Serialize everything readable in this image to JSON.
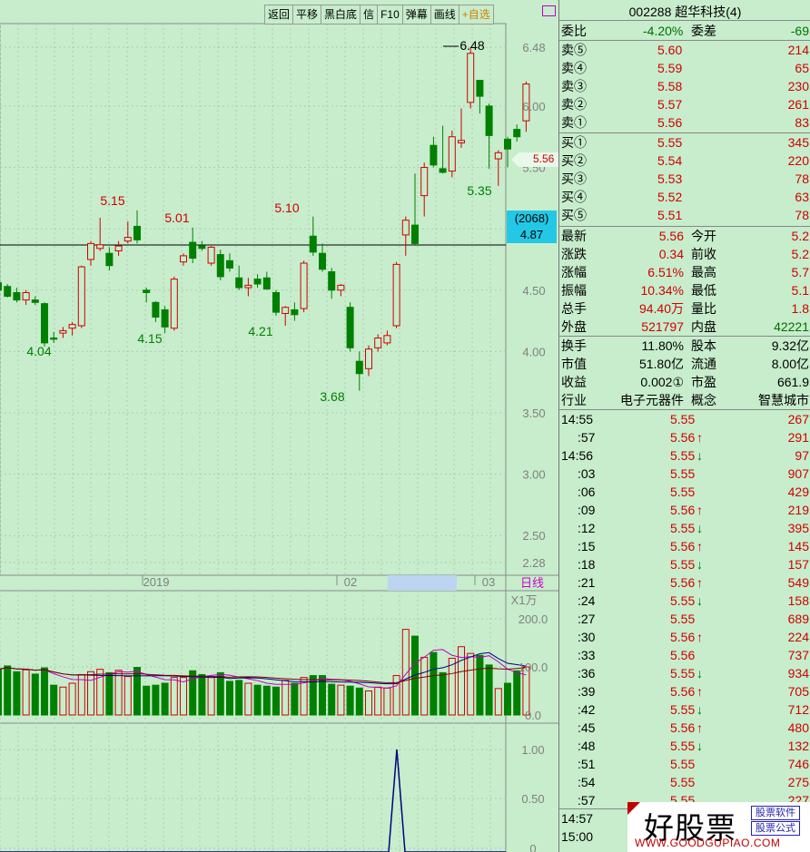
{
  "toolbar": {
    "items": [
      "返回",
      "平移",
      "黑白底",
      "信",
      "F10",
      "弹幕",
      "画线",
      "+自选"
    ]
  },
  "chart": {
    "price_axis": [
      "6.48",
      "6.00",
      "5.50",
      "5.00",
      "4.50",
      "4.00",
      "3.50",
      "3.00",
      "2.50",
      "2.28"
    ],
    "volume_axis": [
      "200.0",
      "100.0",
      "0.0"
    ],
    "volume_unit": "X1万",
    "indicator_axis": [
      "1.00",
      "0.50",
      "0"
    ],
    "date_labels": [
      "2019",
      "02",
      "03"
    ],
    "period_label": "日线",
    "annotations": [
      "6.48",
      "5.15",
      "5.01",
      "5.10",
      "5.35",
      "4.04",
      "4.15",
      "4.21",
      "3.68"
    ],
    "last_price_flag": "5.56",
    "crosshair_box": {
      "line1": "(2068)",
      "line2": "4.87"
    },
    "colors": {
      "up": "#d00000",
      "down": "#008000",
      "background": "#c7edcc",
      "ma1": "#000080",
      "ma2": "#c000c0",
      "ma3": "#800000"
    }
  },
  "chart_data": {
    "type": "candlestick",
    "candles": [
      [
        4.56,
        4.56,
        4.5,
        4.5
      ],
      [
        4.53,
        4.55,
        4.44,
        4.45
      ],
      [
        4.48,
        4.52,
        4.4,
        4.42
      ],
      [
        4.42,
        4.5,
        4.38,
        4.48
      ],
      [
        4.42,
        4.45,
        4.38,
        4.4
      ],
      [
        4.39,
        4.4,
        4.04,
        4.07
      ],
      [
        4.11,
        4.16,
        4.07,
        4.1
      ],
      [
        4.15,
        4.2,
        4.11,
        4.17
      ],
      [
        4.19,
        4.24,
        4.13,
        4.22
      ],
      [
        4.21,
        4.7,
        4.19,
        4.69
      ],
      [
        4.75,
        4.9,
        4.7,
        4.88
      ],
      [
        4.84,
        5.09,
        4.82,
        4.87
      ],
      [
        4.8,
        4.85,
        4.66,
        4.7
      ],
      [
        4.82,
        4.9,
        4.78,
        4.86
      ],
      [
        4.9,
        5.06,
        4.88,
        4.93
      ],
      [
        5.02,
        5.15,
        4.88,
        4.91
      ],
      [
        4.5,
        4.52,
        4.4,
        4.48
      ],
      [
        4.4,
        4.41,
        4.24,
        4.28
      ],
      [
        4.34,
        4.37,
        4.15,
        4.2
      ],
      [
        4.19,
        4.61,
        4.17,
        4.59
      ],
      [
        4.73,
        4.8,
        4.7,
        4.78
      ],
      [
        4.89,
        5.01,
        4.72,
        4.76
      ],
      [
        4.86,
        4.9,
        4.82,
        4.84
      ],
      [
        4.72,
        4.86,
        4.7,
        4.85
      ],
      [
        4.79,
        4.83,
        4.58,
        4.61
      ],
      [
        4.74,
        4.8,
        4.65,
        4.68
      ],
      [
        4.6,
        4.7,
        4.5,
        4.52
      ],
      [
        4.52,
        4.6,
        4.45,
        4.54
      ],
      [
        4.59,
        4.63,
        4.52,
        4.55
      ],
      [
        4.6,
        4.65,
        4.5,
        4.51
      ],
      [
        4.48,
        4.5,
        4.29,
        4.32
      ],
      [
        4.31,
        4.37,
        4.21,
        4.36
      ],
      [
        4.34,
        4.4,
        4.25,
        4.3
      ],
      [
        4.35,
        4.74,
        4.32,
        4.72
      ],
      [
        4.94,
        5.1,
        4.78,
        4.81
      ],
      [
        4.8,
        4.88,
        4.65,
        4.67
      ],
      [
        4.65,
        4.68,
        4.43,
        4.5
      ],
      [
        4.5,
        4.55,
        4.45,
        4.54
      ],
      [
        4.36,
        4.4,
        4.0,
        4.03
      ],
      [
        3.92,
        4.0,
        3.68,
        3.82
      ],
      [
        3.86,
        4.05,
        3.8,
        4.02
      ],
      [
        4.03,
        4.14,
        4.0,
        4.11
      ],
      [
        4.07,
        4.17,
        4.05,
        4.13
      ],
      [
        4.21,
        4.73,
        4.19,
        4.71
      ],
      [
        4.95,
        5.1,
        4.78,
        5.07
      ],
      [
        5.03,
        5.45,
        4.87,
        4.88
      ],
      [
        5.27,
        5.54,
        5.1,
        5.5
      ],
      [
        5.68,
        5.75,
        5.5,
        5.52
      ],
      [
        5.49,
        5.84,
        5.45,
        5.46
      ],
      [
        5.47,
        5.8,
        5.42,
        5.75
      ],
      [
        5.7,
        5.98,
        5.66,
        5.72
      ],
      [
        6.03,
        6.48,
        5.98,
        6.43
      ],
      [
        6.21,
        6.1,
        5.94,
        6.08
      ],
      [
        6.0,
        6.02,
        5.49,
        5.76
      ],
      [
        5.57,
        5.64,
        5.35,
        5.62
      ],
      [
        5.73,
        5.75,
        5.5,
        5.65
      ],
      [
        5.81,
        5.85,
        5.71,
        5.75
      ],
      [
        5.88,
        6.2,
        5.79,
        6.18
      ]
    ],
    "volume_ylim": [
      0,
      200
    ],
    "price_ylim": [
      2.28,
      6.48
    ]
  },
  "panel": {
    "title": "002288 超华科技(4)",
    "weibi": {
      "label": "委比",
      "value": "-4.20%",
      "label2": "委差",
      "value2": "-69"
    },
    "asks": [
      {
        "label": "卖⑤",
        "price": "5.60",
        "vol": "214"
      },
      {
        "label": "卖④",
        "price": "5.59",
        "vol": "65"
      },
      {
        "label": "卖③",
        "price": "5.58",
        "vol": "230"
      },
      {
        "label": "卖②",
        "price": "5.57",
        "vol": "261"
      },
      {
        "label": "卖①",
        "price": "5.56",
        "vol": "83"
      }
    ],
    "bids": [
      {
        "label": "买①",
        "price": "5.55",
        "vol": "345"
      },
      {
        "label": "买②",
        "price": "5.54",
        "vol": "220"
      },
      {
        "label": "买③",
        "price": "5.53",
        "vol": "78"
      },
      {
        "label": "买④",
        "price": "5.52",
        "vol": "63"
      },
      {
        "label": "买⑤",
        "price": "5.51",
        "vol": "78"
      }
    ],
    "stats": [
      {
        "l1": "最新",
        "v1": "5.56",
        "l2": "今开",
        "v2": "5.2"
      },
      {
        "l1": "涨跌",
        "v1": "0.34",
        "l2": "前收",
        "v2": "5.2"
      },
      {
        "l1": "涨幅",
        "v1": "6.51%",
        "l2": "最高",
        "v2": "5.7"
      },
      {
        "l1": "振幅",
        "v1": "10.34%",
        "l2": "最低",
        "v2": "5.1"
      },
      {
        "l1": "总手",
        "v1": "94.40万",
        "l2": "量比",
        "v2": "1.8"
      },
      {
        "l1": "外盘",
        "v1": "521797",
        "l2": "内盘",
        "v2": "42221"
      }
    ],
    "fundamentals": [
      {
        "l1": "换手",
        "v1": "11.80%",
        "l2": "股本",
        "v2": "9.32亿"
      },
      {
        "l1": "市值",
        "v1": "51.80亿",
        "l2": "流通",
        "v2": "8.00亿"
      },
      {
        "l1": "收益",
        "v1": "0.002①",
        "l2": "市盈",
        "v2": "661.9"
      },
      {
        "l1": "行业",
        "v1": "电子元器件",
        "l2": "概念",
        "v2": "智慧城市"
      }
    ],
    "ticks": [
      {
        "t": "14:55",
        "p": "5.55",
        "a": "",
        "v": "267"
      },
      {
        "t": ":57",
        "p": "5.56",
        "a": "↑",
        "v": "291"
      },
      {
        "t": "14:56",
        "p": "5.55",
        "a": "↓",
        "v": "97"
      },
      {
        "t": ":03",
        "p": "5.55",
        "a": "",
        "v": "907"
      },
      {
        "t": ":06",
        "p": "5.55",
        "a": "",
        "v": "429"
      },
      {
        "t": ":09",
        "p": "5.56",
        "a": "↑",
        "v": "219"
      },
      {
        "t": ":12",
        "p": "5.55",
        "a": "↓",
        "v": "395"
      },
      {
        "t": ":15",
        "p": "5.56",
        "a": "↑",
        "v": "145"
      },
      {
        "t": ":18",
        "p": "5.55",
        "a": "↓",
        "v": "157"
      },
      {
        "t": ":21",
        "p": "5.56",
        "a": "↑",
        "v": "549"
      },
      {
        "t": ":24",
        "p": "5.55",
        "a": "↓",
        "v": "158"
      },
      {
        "t": ":27",
        "p": "5.55",
        "a": "",
        "v": "689"
      },
      {
        "t": ":30",
        "p": "5.56",
        "a": "↑",
        "v": "224"
      },
      {
        "t": ":33",
        "p": "5.56",
        "a": "",
        "v": "737"
      },
      {
        "t": ":36",
        "p": "5.55",
        "a": "↓",
        "v": "934"
      },
      {
        "t": ":39",
        "p": "5.56",
        "a": "↑",
        "v": "705"
      },
      {
        "t": ":42",
        "p": "5.55",
        "a": "↓",
        "v": "712"
      },
      {
        "t": ":45",
        "p": "5.56",
        "a": "↑",
        "v": "480"
      },
      {
        "t": ":48",
        "p": "5.55",
        "a": "↓",
        "v": "132"
      },
      {
        "t": ":51",
        "p": "5.55",
        "a": "",
        "v": "746"
      },
      {
        "t": ":54",
        "p": "5.55",
        "a": "",
        "v": "275"
      },
      {
        "t": ":57",
        "p": "5.55",
        "a": "",
        "v": "227"
      },
      {
        "t": "14:57",
        "p": "",
        "a": "",
        "v": ""
      },
      {
        "t": "15:00",
        "p": "",
        "a": "",
        "v": ""
      }
    ]
  },
  "watermark": {
    "main": "好股票",
    "tag1": "股票软件",
    "tag2": "股票公式",
    "url": "WWW.GOODGUPIAO.COM"
  }
}
